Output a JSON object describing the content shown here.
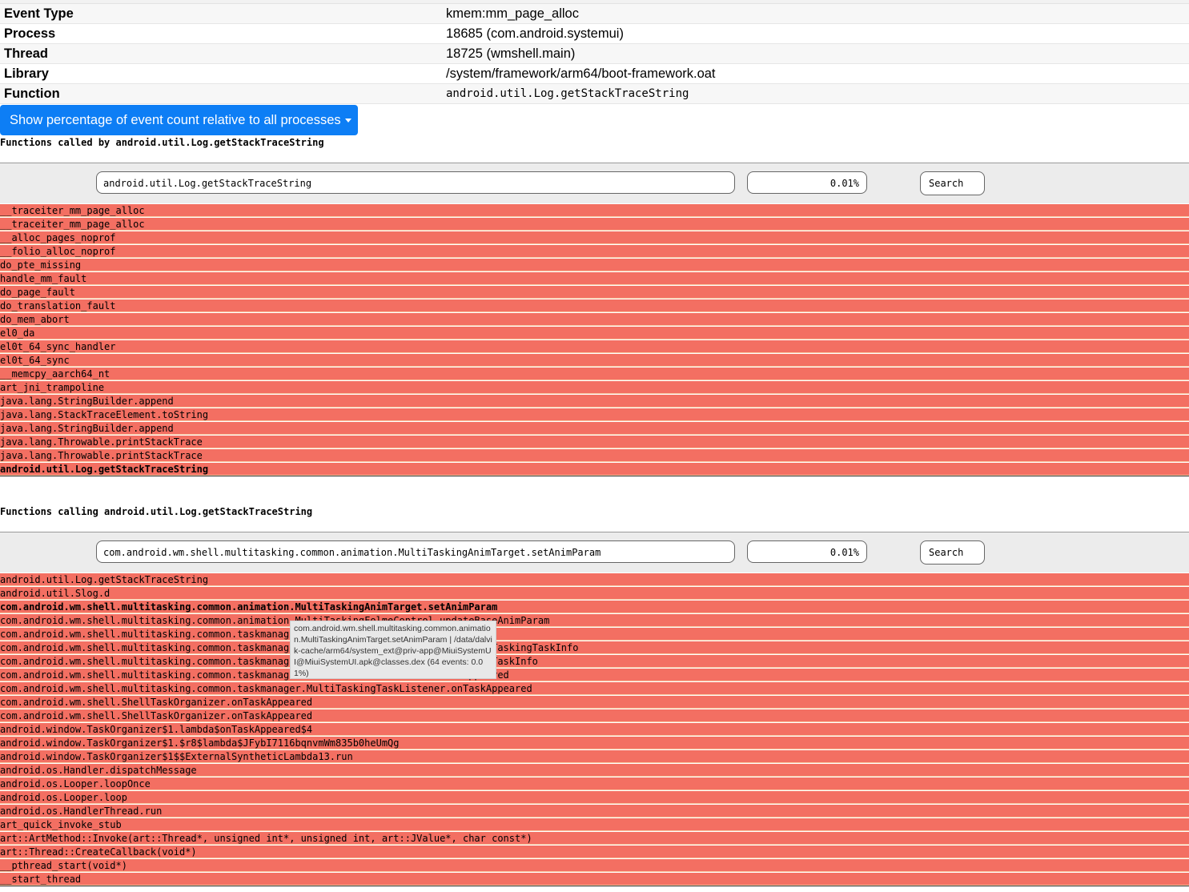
{
  "info": [
    {
      "label": "Event Type",
      "value": "kmem:mm_page_alloc",
      "mono": false
    },
    {
      "label": "Process",
      "value": "18685 (com.android.systemui)",
      "mono": false
    },
    {
      "label": "Thread",
      "value": "18725 (wmshell.main)",
      "mono": false
    },
    {
      "label": "Library",
      "value": "/system/framework/arm64/boot-framework.oat",
      "mono": false
    },
    {
      "label": "Function",
      "value": "android.util.Log.getStackTraceString",
      "mono": true
    }
  ],
  "percentage_button": {
    "label": "Show percentage of event count relative to all processes"
  },
  "callees": {
    "heading": "Functions called by android.util.Log.getStackTraceString",
    "search_value": "android.util.Log.getStackTraceString",
    "percent": "0.01%",
    "search_label": "Search",
    "rows": [
      "__traceiter_mm_page_alloc",
      "__traceiter_mm_page_alloc",
      "__alloc_pages_noprof",
      "__folio_alloc_noprof",
      "do_pte_missing",
      "handle_mm_fault",
      "do_page_fault",
      "do_translation_fault",
      "do_mem_abort",
      "el0_da",
      "el0t_64_sync_handler",
      "el0t_64_sync",
      "__memcpy_aarch64_nt",
      "art_jni_trampoline",
      "java.lang.StringBuilder.append",
      "java.lang.StackTraceElement.toString",
      "java.lang.StringBuilder.append",
      "java.lang.Throwable.printStackTrace",
      "java.lang.Throwable.printStackTrace",
      "android.util.Log.getStackTraceString"
    ],
    "bold_index": 19
  },
  "callers": {
    "heading": "Functions calling android.util.Log.getStackTraceString",
    "search_value": "com.android.wm.shell.multitasking.common.animation.MultiTaskingAnimTarget.setAnimParam",
    "percent": "0.01%",
    "search_label": "Search",
    "rows": [
      "android.util.Log.getStackTraceString",
      "android.util.Slog.d",
      "com.android.wm.shell.multitasking.common.animation.MultiTaskingAnimTarget.setAnimParam",
      "com.android.wm.shell.multitasking.common.animation.MultiTaskingFolmeControl.updateBaseAnimParam",
      "com.android.wm.shell.multitasking.common.taskmanag",
      "com.android.wm.shell.multitasking.common.taskmanag                              MultiTaskingTaskInfo",
      "com.android.wm.shell.multitasking.common.taskmanag                              pdateTaskInfo",
      "com.android.wm.shell.multitasking.common.taskmanag                              Appeared",
      "com.android.wm.shell.multitasking.common.taskmanager.MultiTaskingTaskListener.onTaskAppeared",
      "com.android.wm.shell.ShellTaskOrganizer.onTaskAppeared",
      "com.android.wm.shell.ShellTaskOrganizer.onTaskAppeared",
      "android.window.TaskOrganizer$1.lambda$onTaskAppeared$4",
      "android.window.TaskOrganizer$1.$r8$lambda$JFybI7116bqnvmWm835b0heUmQg",
      "android.window.TaskOrganizer$1$$ExternalSyntheticLambda13.run",
      "android.os.Handler.dispatchMessage",
      "android.os.Looper.loopOnce",
      "android.os.Looper.loop",
      "android.os.HandlerThread.run",
      "art_quick_invoke_stub",
      "art::ArtMethod::Invoke(art::Thread*, unsigned int*, unsigned int, art::JValue*, char const*)",
      "art::Thread::CreateCallback(void*)",
      "__pthread_start(void*)",
      "__start_thread"
    ],
    "bold_index": 2
  },
  "tooltip": "com.android.wm.shell.multitasking.common.animation.MultiTaskingAnimTarget.setAnimParam | /data/dalvik-cache/arm64/system_ext@priv-app@MiuiSystemUI@MiuiSystemUI.apk@classes.dex (64 events: 0.01%)"
}
